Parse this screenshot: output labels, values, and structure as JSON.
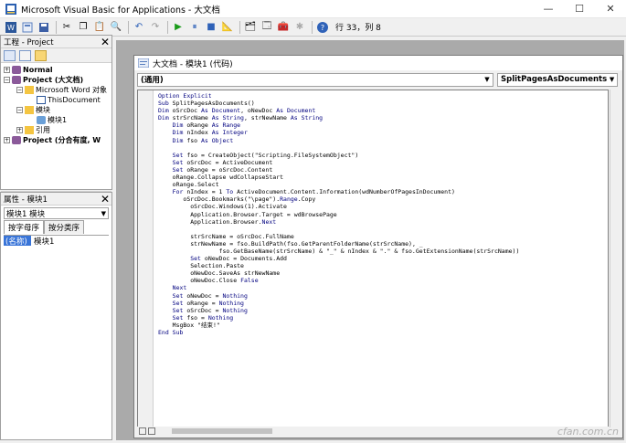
{
  "window": {
    "title": "Microsoft Visual Basic for Applications - 大文档"
  },
  "toolbar": {
    "status": "行 33，列 8"
  },
  "project_panel": {
    "title": "工程 - Project",
    "tree": [
      {
        "label": "Normal",
        "bold": true,
        "exp": "+"
      },
      {
        "label": "Project (大文档)",
        "bold": true,
        "exp": "−"
      },
      {
        "label": "Microsoft Word 对象",
        "bold": true,
        "exp": "−"
      },
      {
        "label": "ThisDocument",
        "bold": false,
        "exp": ""
      },
      {
        "label": "模块",
        "bold": false,
        "exp": "−"
      },
      {
        "label": "模块1",
        "bold": false,
        "exp": ""
      },
      {
        "label": "引用",
        "bold": false,
        "exp": "+"
      },
      {
        "label": "Project (分合有度, W",
        "bold": true,
        "exp": "+"
      }
    ]
  },
  "props_panel": {
    "title": "属性 - 模块1",
    "object": "模块1 模块",
    "tabs": [
      "按字母序",
      "按分类序"
    ],
    "prop_name": "(名称)",
    "prop_value": "模块1"
  },
  "code_window": {
    "title": "大文档 - 模块1 (代码)",
    "object_combo": "(通用)",
    "proc_combo": "SplitPagesAsDocuments",
    "lines": [
      "Option Explicit",
      "Sub SplitPagesAsDocuments()",
      "Dim oSrcDoc As Document, oNewDoc As Document",
      "Dim strSrcName As String, strNewName As String",
      "    Dim oRange As Range",
      "    Dim nIndex As Integer",
      "    Dim fso As Object",
      "",
      "    Set fso = CreateObject(\"Scripting.FileSystemObject\")",
      "    Set oSrcDoc = ActiveDocument",
      "    Set oRange = oSrcDoc.Content",
      "    oRange.Collapse wdCollapseStart",
      "    oRange.Select",
      "    For nIndex = 1 To ActiveDocument.Content.Information(wdNumberOfPagesInDocument)",
      "       oSrcDoc.Bookmarks(\"\\page\").Range.Copy",
      "         oSrcDoc.Windows(1).Activate",
      "         Application.Browser.Target = wdBrowsePage",
      "         Application.Browser.Next",
      "",
      "         strSrcName = oSrcDoc.FullName",
      "         strNewName = fso.BuildPath(fso.GetParentFolderName(strSrcName), _",
      "                 fso.GetBaseName(strSrcName) & \"_\" & nIndex & \".\" & fso.GetExtensionName(strSrcName))",
      "         Set oNewDoc = Documents.Add",
      "         Selection.Paste",
      "         oNewDoc.SaveAs strNewName",
      "         oNewDoc.Close False",
      "    Next",
      "    Set oNewDoc = Nothing",
      "    Set oRange = Nothing",
      "    Set oSrcDoc = Nothing",
      "    Set fso = Nothing",
      "    MsgBox \"结束!\"",
      "End Sub"
    ]
  },
  "watermark": "cfan.com.cn",
  "colors": {
    "keyword": "#00007f",
    "selection": "#3874d8"
  }
}
